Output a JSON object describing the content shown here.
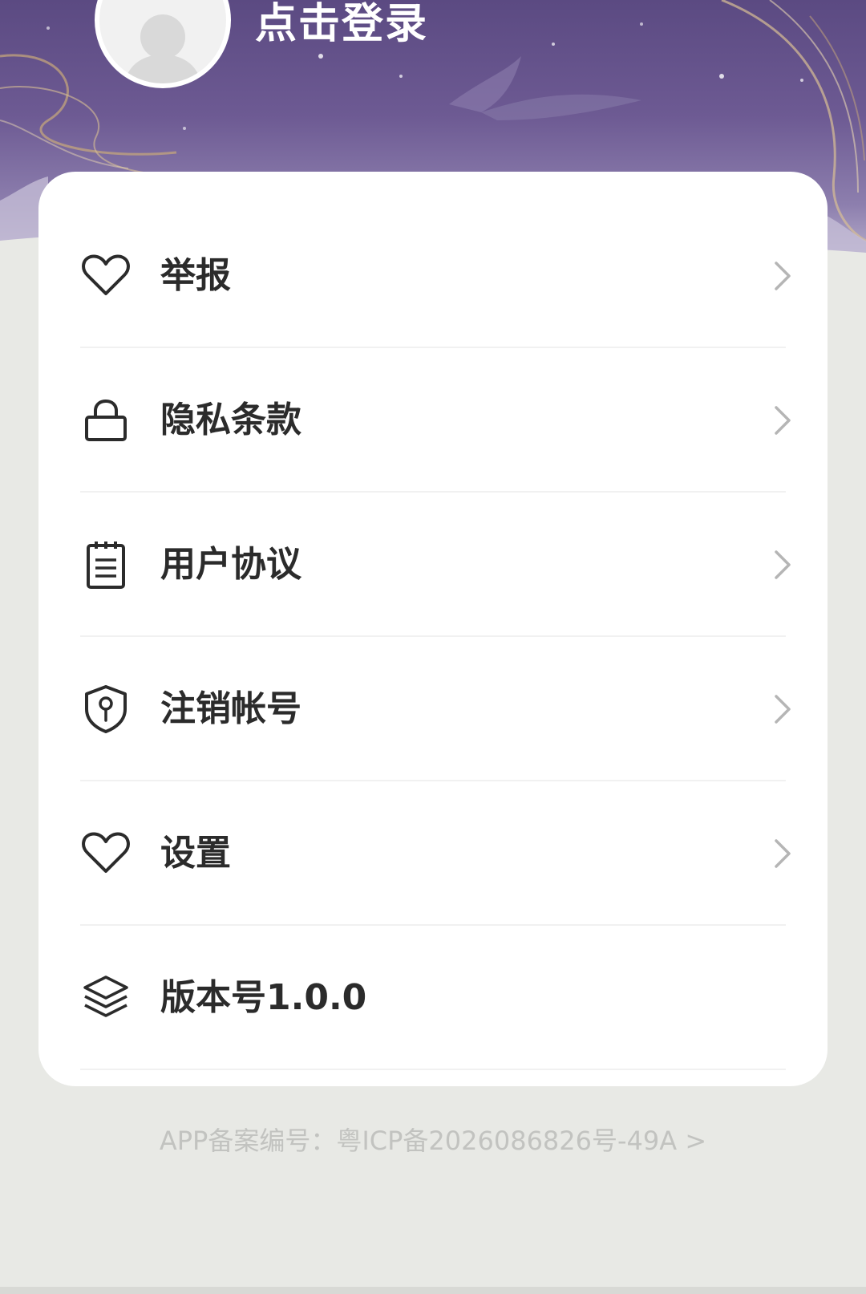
{
  "header": {
    "login_label": "点击登录"
  },
  "menu": {
    "items": [
      {
        "label": "举报",
        "icon": "heart-icon"
      },
      {
        "label": "隐私条款",
        "icon": "lock-icon"
      },
      {
        "label": "用户协议",
        "icon": "notepad-icon"
      },
      {
        "label": "注销帐号",
        "icon": "shield-keyhole-icon"
      },
      {
        "label": "设置",
        "icon": "heart-icon"
      },
      {
        "label": "版本号1.0.0",
        "icon": "layers-icon"
      }
    ]
  },
  "footer": {
    "icp_text": "APP备案编号：粤ICP备2026086826号-49A >"
  },
  "colors": {
    "hero": "#5b4a82",
    "background": "#e8e9e5",
    "card": "#ffffff",
    "text": "#2b2b2b",
    "footer_text": "#c2c3c0"
  }
}
